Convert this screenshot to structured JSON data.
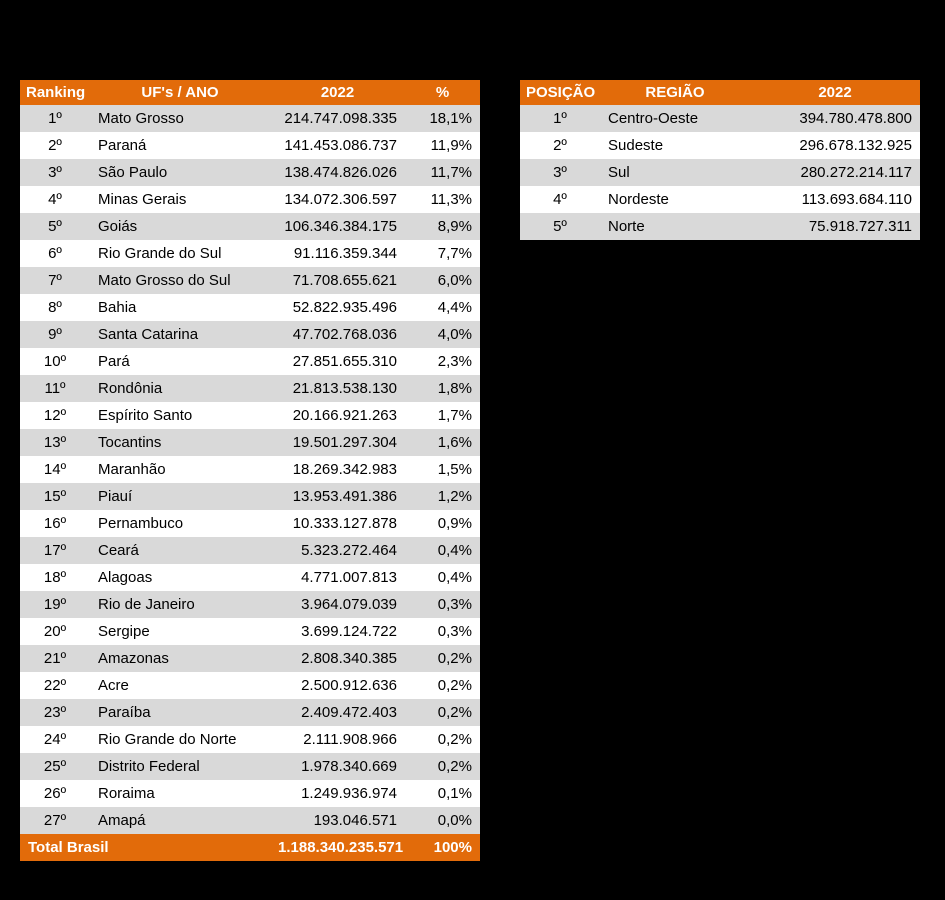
{
  "left": {
    "headers": {
      "rank": "Ranking",
      "name": "UF's / ANO",
      "value": "2022",
      "pct": "%"
    },
    "rows": [
      {
        "rank": "1º",
        "name": "Mato Grosso",
        "value": "214.747.098.335",
        "pct": "18,1%"
      },
      {
        "rank": "2º",
        "name": "Paraná",
        "value": "141.453.086.737",
        "pct": "11,9%"
      },
      {
        "rank": "3º",
        "name": "São Paulo",
        "value": "138.474.826.026",
        "pct": "11,7%"
      },
      {
        "rank": "4º",
        "name": "Minas Gerais",
        "value": "134.072.306.597",
        "pct": "11,3%"
      },
      {
        "rank": "5º",
        "name": "Goiás",
        "value": "106.346.384.175",
        "pct": "8,9%"
      },
      {
        "rank": "6º",
        "name": "Rio Grande do Sul",
        "value": "91.116.359.344",
        "pct": "7,7%"
      },
      {
        "rank": "7º",
        "name": "Mato Grosso do Sul",
        "value": "71.708.655.621",
        "pct": "6,0%"
      },
      {
        "rank": "8º",
        "name": "Bahia",
        "value": "52.822.935.496",
        "pct": "4,4%"
      },
      {
        "rank": "9º",
        "name": "Santa Catarina",
        "value": "47.702.768.036",
        "pct": "4,0%"
      },
      {
        "rank": "10º",
        "name": "Pará",
        "value": "27.851.655.310",
        "pct": "2,3%"
      },
      {
        "rank": "11º",
        "name": "Rondônia",
        "value": "21.813.538.130",
        "pct": "1,8%"
      },
      {
        "rank": "12º",
        "name": "Espírito Santo",
        "value": "20.166.921.263",
        "pct": "1,7%"
      },
      {
        "rank": "13º",
        "name": "Tocantins",
        "value": "19.501.297.304",
        "pct": "1,6%"
      },
      {
        "rank": "14º",
        "name": "Maranhão",
        "value": "18.269.342.983",
        "pct": "1,5%"
      },
      {
        "rank": "15º",
        "name": "Piauí",
        "value": "13.953.491.386",
        "pct": "1,2%"
      },
      {
        "rank": "16º",
        "name": "Pernambuco",
        "value": "10.333.127.878",
        "pct": "0,9%"
      },
      {
        "rank": "17º",
        "name": "Ceará",
        "value": "5.323.272.464",
        "pct": "0,4%"
      },
      {
        "rank": "18º",
        "name": "Alagoas",
        "value": "4.771.007.813",
        "pct": "0,4%"
      },
      {
        "rank": "19º",
        "name": "Rio de Janeiro",
        "value": "3.964.079.039",
        "pct": "0,3%"
      },
      {
        "rank": "20º",
        "name": "Sergipe",
        "value": "3.699.124.722",
        "pct": "0,3%"
      },
      {
        "rank": "21º",
        "name": "Amazonas",
        "value": "2.808.340.385",
        "pct": "0,2%"
      },
      {
        "rank": "22º",
        "name": "Acre",
        "value": "2.500.912.636",
        "pct": "0,2%"
      },
      {
        "rank": "23º",
        "name": "Paraíba",
        "value": "2.409.472.403",
        "pct": "0,2%"
      },
      {
        "rank": "24º",
        "name": "Rio Grande do Norte",
        "value": "2.111.908.966",
        "pct": "0,2%"
      },
      {
        "rank": "25º",
        "name": "Distrito Federal",
        "value": "1.978.340.669",
        "pct": "0,2%"
      },
      {
        "rank": "26º",
        "name": "Roraima",
        "value": "1.249.936.974",
        "pct": "0,1%"
      },
      {
        "rank": "27º",
        "name": "Amapá",
        "value": "193.046.571",
        "pct": "0,0%"
      }
    ],
    "total": {
      "name": "Total Brasil",
      "value": "1.188.340.235.571",
      "pct": "100%"
    }
  },
  "right": {
    "headers": {
      "rank": "POSIÇÃO",
      "name": "REGIÃO",
      "value": "2022"
    },
    "rows": [
      {
        "rank": "1º",
        "name": "Centro-Oeste",
        "value": "394.780.478.800"
      },
      {
        "rank": "2º",
        "name": "Sudeste",
        "value": "296.678.132.925"
      },
      {
        "rank": "3º",
        "name": "Sul",
        "value": "280.272.214.117"
      },
      {
        "rank": "4º",
        "name": "Nordeste",
        "value": "113.693.684.110"
      },
      {
        "rank": "5º",
        "name": "Norte",
        "value": "75.918.727.311"
      }
    ]
  }
}
